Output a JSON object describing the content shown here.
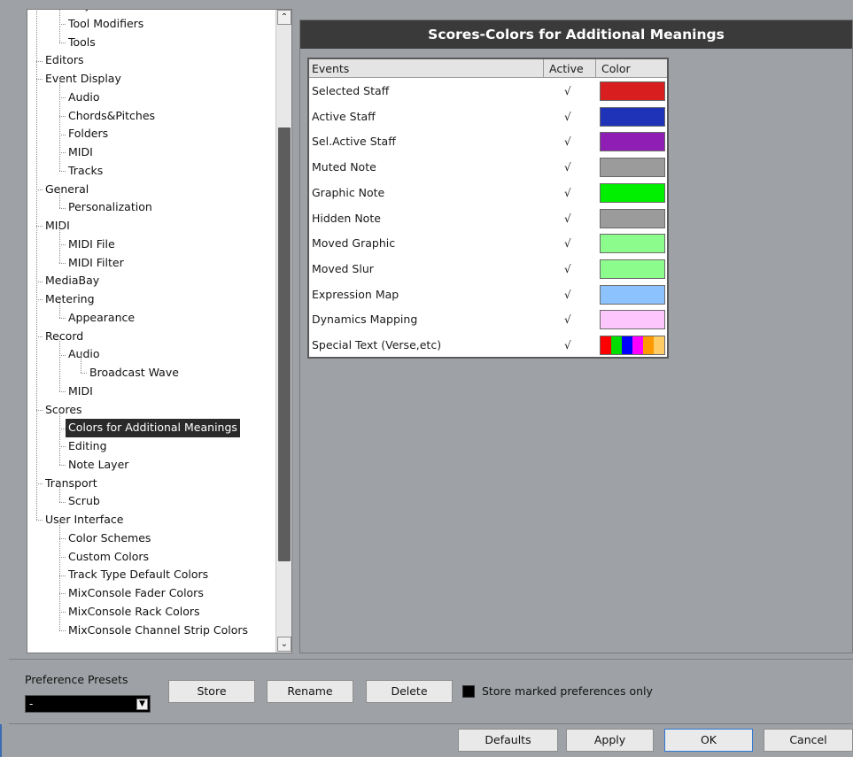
{
  "tree": {
    "items": [
      {
        "label": "Project & MixConsole",
        "level": 1
      },
      {
        "label": "Tool Modifiers",
        "level": 1
      },
      {
        "label": "Tools",
        "level": 1
      },
      {
        "label": "Editors",
        "level": 0
      },
      {
        "label": "Event Display",
        "level": 0
      },
      {
        "label": "Audio",
        "level": 1
      },
      {
        "label": "Chords&Pitches",
        "level": 1
      },
      {
        "label": "Folders",
        "level": 1
      },
      {
        "label": "MIDI",
        "level": 1
      },
      {
        "label": "Tracks",
        "level": 1
      },
      {
        "label": "General",
        "level": 0
      },
      {
        "label": "Personalization",
        "level": 1
      },
      {
        "label": "MIDI",
        "level": 0
      },
      {
        "label": "MIDI File",
        "level": 1
      },
      {
        "label": "MIDI Filter",
        "level": 1
      },
      {
        "label": "MediaBay",
        "level": 0
      },
      {
        "label": "Metering",
        "level": 0
      },
      {
        "label": "Appearance",
        "level": 1
      },
      {
        "label": "Record",
        "level": 0
      },
      {
        "label": "Audio",
        "level": 1
      },
      {
        "label": "Broadcast Wave",
        "level": 2
      },
      {
        "label": "MIDI",
        "level": 1
      },
      {
        "label": "Scores",
        "level": 0
      },
      {
        "label": "Colors for Additional Meanings",
        "level": 1,
        "selected": true
      },
      {
        "label": "Editing",
        "level": 1
      },
      {
        "label": "Note Layer",
        "level": 1
      },
      {
        "label": "Transport",
        "level": 0
      },
      {
        "label": "Scrub",
        "level": 1
      },
      {
        "label": "User Interface",
        "level": 0
      },
      {
        "label": "Color Schemes",
        "level": 1
      },
      {
        "label": "Custom Colors",
        "level": 1
      },
      {
        "label": "Track Type Default Colors",
        "level": 1
      },
      {
        "label": "MixConsole Fader Colors",
        "level": 1
      },
      {
        "label": "MixConsole Rack Colors",
        "level": 1
      },
      {
        "label": "MixConsole Channel Strip Colors",
        "level": 1
      }
    ]
  },
  "scrollbar": {
    "up_glyph": "⌃",
    "down_glyph": "⌄"
  },
  "panel": {
    "title": "Scores-Colors for Additional Meanings",
    "columns": [
      "Events",
      "Active",
      "Color"
    ],
    "rows": [
      {
        "event": "Selected Staff",
        "active": "√",
        "color": "#d81e1e"
      },
      {
        "event": "Active Staff",
        "active": "√",
        "color": "#1e33b8"
      },
      {
        "event": "Sel.Active Staff",
        "active": "√",
        "color": "#8e1eb4"
      },
      {
        "event": "Muted Note",
        "active": "√",
        "color": "#9b9b9b"
      },
      {
        "event": "Graphic Note",
        "active": "√",
        "color": "#00f000"
      },
      {
        "event": "Hidden Note",
        "active": "√",
        "color": "#9b9b9b"
      },
      {
        "event": "Moved Graphic",
        "active": "√",
        "color": "#8cfc8c"
      },
      {
        "event": "Moved Slur",
        "active": "√",
        "color": "#8cfc8c"
      },
      {
        "event": "Expression Map",
        "active": "√",
        "color": "#8cc3ff"
      },
      {
        "event": "Dynamics Mapping",
        "active": "√",
        "color": "#fdc7fd"
      },
      {
        "event": "Special Text (Verse,etc)",
        "active": "√",
        "colors": [
          "#ff0000",
          "#00dd00",
          "#0000ff",
          "#ff00ff",
          "#ff9900",
          "#ffcc66"
        ]
      }
    ]
  },
  "presets": {
    "label": "Preference Presets",
    "selected": "-",
    "store": "Store",
    "rename": "Rename",
    "delete": "Delete",
    "store_marked_label": "Store marked preferences only"
  },
  "footer": {
    "defaults": "Defaults",
    "apply": "Apply",
    "ok": "OK",
    "cancel": "Cancel"
  }
}
